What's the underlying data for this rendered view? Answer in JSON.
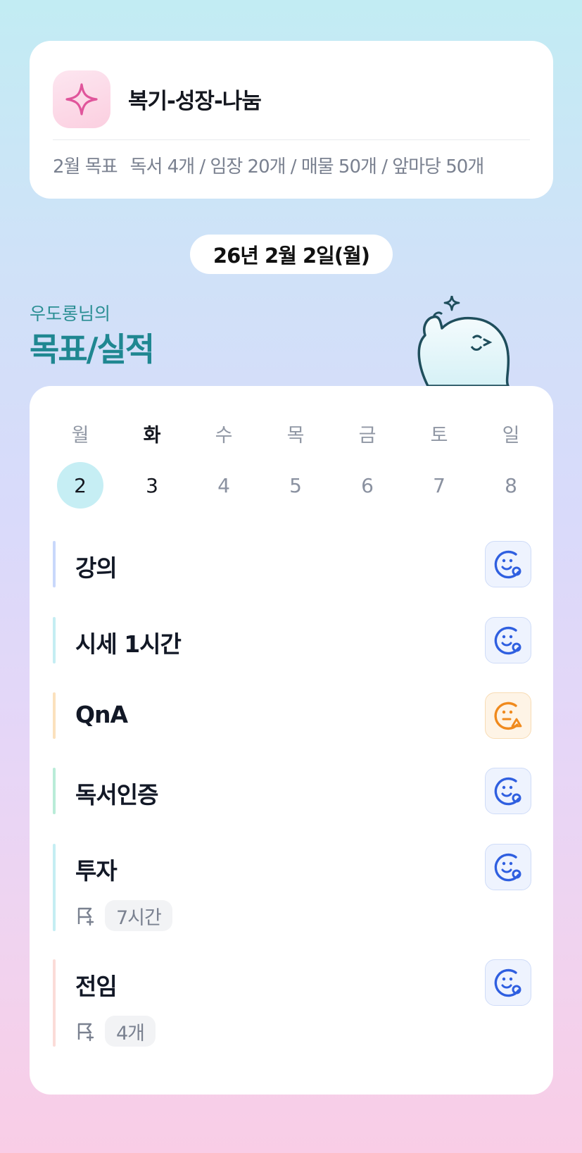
{
  "goal_card": {
    "title": "복기-성장-나눔",
    "goal_label": "2월 목표",
    "goal_text": "독서 4개 / 임장 20개 / 매물 50개 / 앞마당 50개"
  },
  "date": "26년 2월 2일(월)",
  "owner": "우도롱님의",
  "section_title": "목표/실적",
  "week": {
    "days": [
      {
        "name": "월",
        "num": "2"
      },
      {
        "name": "화",
        "num": "3"
      },
      {
        "name": "수",
        "num": "4"
      },
      {
        "name": "목",
        "num": "5"
      },
      {
        "name": "금",
        "num": "6"
      },
      {
        "name": "토",
        "num": "7"
      },
      {
        "name": "일",
        "num": "8"
      }
    ],
    "selected_index": 0,
    "today_index": 1
  },
  "tasks": [
    {
      "label": "강의",
      "status": "done",
      "bar_color": "#c9d8fb",
      "status_icon": "smile-check-icon"
    },
    {
      "label": "시세 1시간",
      "status": "done",
      "bar_color": "#c5eef3",
      "status_icon": "smile-check-icon"
    },
    {
      "label": "QnA",
      "status": "partial",
      "bar_color": "#fbe1bd",
      "status_icon": "neutral-triangle-icon"
    },
    {
      "label": "독서인증",
      "status": "done",
      "bar_color": "#b9ecd8",
      "status_icon": "smile-check-icon"
    },
    {
      "label": "투자",
      "status": "done",
      "bar_color": "#c5eef3",
      "status_icon": "smile-check-icon",
      "target": "7시간"
    },
    {
      "label": "전임",
      "status": "done",
      "bar_color": "#fbdcd8",
      "status_icon": "smile-check-icon",
      "target": "4개"
    }
  ],
  "colors": {
    "accent": "#1f8791",
    "selected_day": "#c6eef4",
    "done_icon": "#2f5fe0",
    "partial_icon": "#f08a1d"
  }
}
